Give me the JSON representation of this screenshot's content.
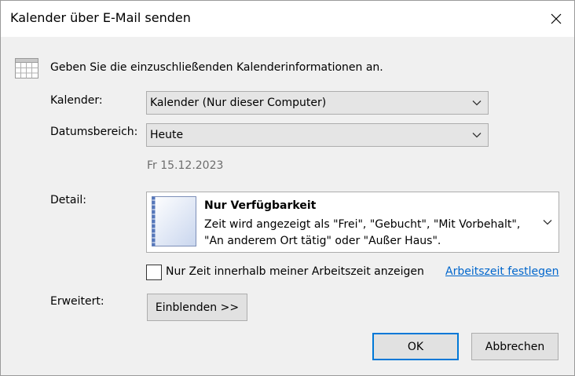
{
  "window": {
    "title": "Kalender über E-Mail senden"
  },
  "intro": {
    "text": "Geben Sie die einzuschließenden Kalenderinformationen an."
  },
  "calendar": {
    "label": "Kalender:",
    "value": "Kalender (Nur dieser Computer)"
  },
  "date_range": {
    "label": "Datumsbereich:",
    "value": "Heute",
    "date": "Fr 15.12.2023"
  },
  "detail": {
    "label": "Detail:",
    "title": "Nur Verfügbarkeit",
    "description": "Zeit wird angezeigt als \"Frei\", \"Gebucht\", \"Mit Vorbehalt\", \"An anderem Ort tätig\" oder \"Außer Haus\"."
  },
  "working_hours": {
    "checkbox_label": "Nur Zeit innerhalb meiner Arbeitszeit anzeigen",
    "checked": false,
    "link": "Arbeitszeit festlegen"
  },
  "advanced": {
    "label": "Erweitert:",
    "button": "Einblenden >>"
  },
  "buttons": {
    "ok": "OK",
    "cancel": "Abbrechen"
  },
  "icons": {
    "close": "close-icon",
    "calendar": "calendar-grid-icon",
    "chevron": "chevron-down-icon",
    "detail_graphic": "calendar-page-icon"
  },
  "colors": {
    "link": "#0066cc",
    "default_button_border": "#0078d7",
    "dialog_bg": "#f0f0f0"
  }
}
